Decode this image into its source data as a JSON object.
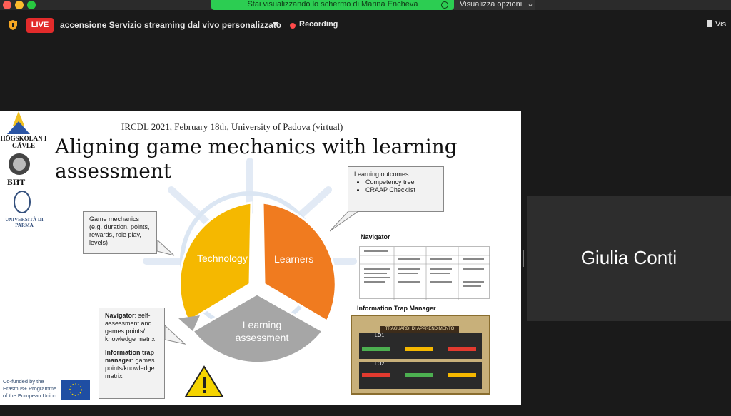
{
  "window": {
    "share_banner": "Stai visualizzando lo schermo di Marina Encheva",
    "view_options": "Visualizza opzioni"
  },
  "zoom_bar": {
    "live_label": "LIVE",
    "stream_title": "accensione Servizio streaming dal vivo personalizzato",
    "recording_label": "Recording",
    "view_label": "Vis"
  },
  "slide": {
    "conference": "IRCDL 2021, February 18th, University of Padova (virtual)",
    "title": "Aligning game mechanics with learning assessment",
    "logos": [
      "HÖGSKOLAN I GÄVLE",
      "БИТ",
      "UNIVERSITÀ DI PARMA"
    ],
    "game_mechanics": "Game mechanics (e.g. duration, points, rewards, role play, levels)",
    "learning_outcomes_title": "Learning outcomes:",
    "learning_outcomes": [
      "Competency tree",
      "CRAAP Checklist"
    ],
    "segments": {
      "technology": "Technology",
      "learners": "Learners",
      "assessment": "Learning assessment"
    },
    "navigator_label": "Navigator",
    "navigator_box_name": "Navigator",
    "navigator_box_text": ": self-assessment and games points/ knowledge matrix",
    "itm_box_name": "Information trap manager",
    "itm_box_text": ": games points/knowledge matrix",
    "itm_label": "Information Trap Manager",
    "itm_panel_title": "TRAGUARDI DI APPRENDIMENTO",
    "itm_lo1": "LO1",
    "itm_lo2": "LO2",
    "eu_text": "Co-funded by the Erasmus+ Programme of the European Union",
    "colors": {
      "technology": "#f5b800",
      "learners": "#f07b1f",
      "assessment": "#a6a6a6"
    }
  },
  "participant": {
    "name": "Giulia Conti"
  }
}
